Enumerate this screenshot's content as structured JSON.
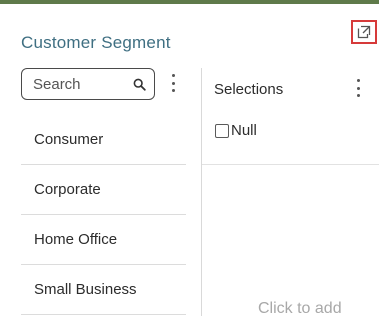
{
  "panel": {
    "title": "Customer Segment",
    "expand_icon": "expand-icon"
  },
  "search": {
    "placeholder": "Search",
    "value": "",
    "icon": "search-icon"
  },
  "list": {
    "items": [
      {
        "label": "Consumer"
      },
      {
        "label": "Corporate"
      },
      {
        "label": "Home Office"
      },
      {
        "label": "Small Business"
      }
    ]
  },
  "selections": {
    "label": "Selections",
    "items": [
      {
        "label": "Null",
        "checked": false
      }
    ],
    "drop_hint": "Click to add"
  },
  "colors": {
    "title": "#3f6f82",
    "highlight_border": "#d63a3a",
    "top_accent": "#5f7a4a"
  }
}
